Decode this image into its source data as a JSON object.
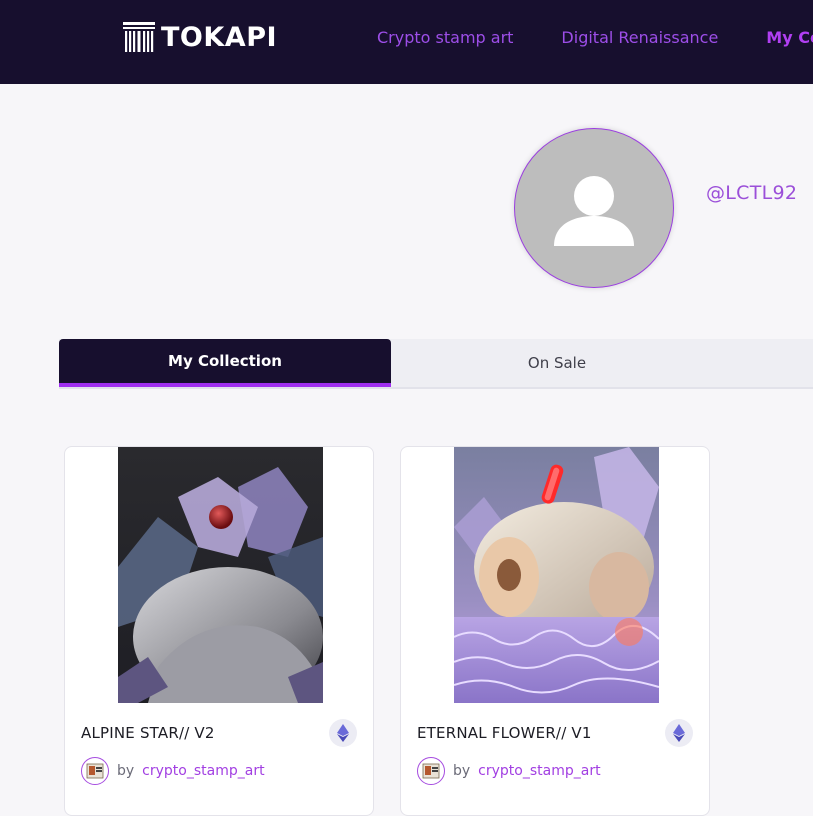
{
  "header": {
    "logo_text": "TOKAPI",
    "nav": [
      {
        "label": "Crypto stamp art"
      },
      {
        "label": "Digital Renaissance"
      },
      {
        "label": "My Coll"
      }
    ]
  },
  "profile": {
    "username": "@LCTL92"
  },
  "tabs": [
    {
      "label": "My Collection",
      "active": true
    },
    {
      "label": "On Sale",
      "active": false
    }
  ],
  "cards": [
    {
      "title": "ALPINE STAR// V2",
      "by": "by",
      "creator": "crypto_stamp_art"
    },
    {
      "title": "ETERNAL FLOWER// V1",
      "by": "by",
      "creator": "crypto_stamp_art"
    }
  ],
  "colors": {
    "header_bg": "#170f2e",
    "accent": "#a02ff0",
    "link": "#9d4ee8"
  }
}
